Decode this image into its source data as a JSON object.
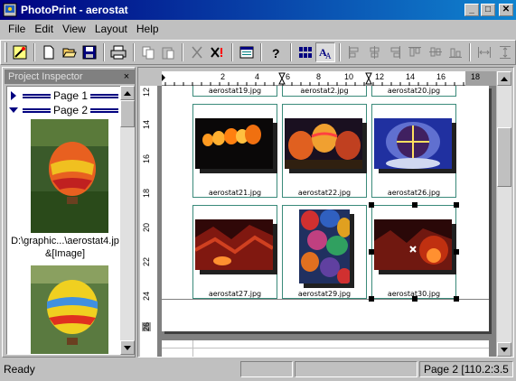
{
  "window": {
    "title": "PhotoPrint - aerostat",
    "minimize_glyph": "_",
    "maximize_glyph": "□",
    "close_glyph": "✕"
  },
  "menu": [
    {
      "label": "File",
      "accel": "F"
    },
    {
      "label": "Edit",
      "accel": "E"
    },
    {
      "label": "View",
      "accel": "V"
    },
    {
      "label": "Layout",
      "accel": "L"
    },
    {
      "label": "Help",
      "accel": "H"
    }
  ],
  "toolbar": {
    "icons": [
      "wizard-icon",
      "new-icon",
      "open-icon",
      "save-icon",
      "print-icon",
      "copy-icon",
      "paste-icon",
      "cut-icon",
      "delete-icon",
      "properties-icon",
      "help-icon",
      "grid-view-icon",
      "font-icon",
      "align-left-icon",
      "align-center-icon",
      "align-right-icon",
      "align-top-icon",
      "align-middle-icon",
      "align-bottom-icon",
      "space-horizontal-icon",
      "space-vertical-icon"
    ]
  },
  "inspector": {
    "title": "Project Inspector",
    "close_glyph": "×",
    "pages": [
      {
        "label": "Page 1",
        "expanded": false
      },
      {
        "label": "Page 2",
        "expanded": true
      }
    ],
    "image_caption_line1": "D:\\graphic...\\aerostat4.jp",
    "image_caption_line2": "&[Image]"
  },
  "rulers": {
    "h_ticks": [
      "2",
      "4",
      "6",
      "8",
      "10",
      "12",
      "14",
      "16",
      "18"
    ],
    "v_ticks": [
      "12",
      "14",
      "16",
      "18",
      "20",
      "22",
      "24",
      "26"
    ]
  },
  "photos": [
    {
      "label": "aerostat19.jpg",
      "row": 0,
      "col": 0,
      "visible_photo": false
    },
    {
      "label": "aerostat2.jpg",
      "row": 0,
      "col": 1,
      "visible_photo": false
    },
    {
      "label": "aerostat20.jpg",
      "row": 0,
      "col": 2,
      "visible_photo": false
    },
    {
      "label": "aerostat21.jpg",
      "row": 1,
      "col": 0,
      "visible_photo": true
    },
    {
      "label": "aerostat22.jpg",
      "row": 1,
      "col": 1,
      "visible_photo": true
    },
    {
      "label": "aerostat26.jpg",
      "row": 1,
      "col": 2,
      "visible_photo": true
    },
    {
      "label": "aerostat27.jpg",
      "row": 2,
      "col": 0,
      "visible_photo": true
    },
    {
      "label": "aerostat29.jpg",
      "row": 2,
      "col": 1,
      "visible_photo": true
    },
    {
      "label": "aerostat30.jpg",
      "row": 2,
      "col": 2,
      "visible_photo": true,
      "selected": true
    }
  ],
  "status": {
    "message": "Ready",
    "position": "Page 2 [110.2:3.5"
  },
  "colors": {
    "title_active": "#000080",
    "cell_border": "#3a8a7a",
    "face": "#c0c0c0"
  }
}
